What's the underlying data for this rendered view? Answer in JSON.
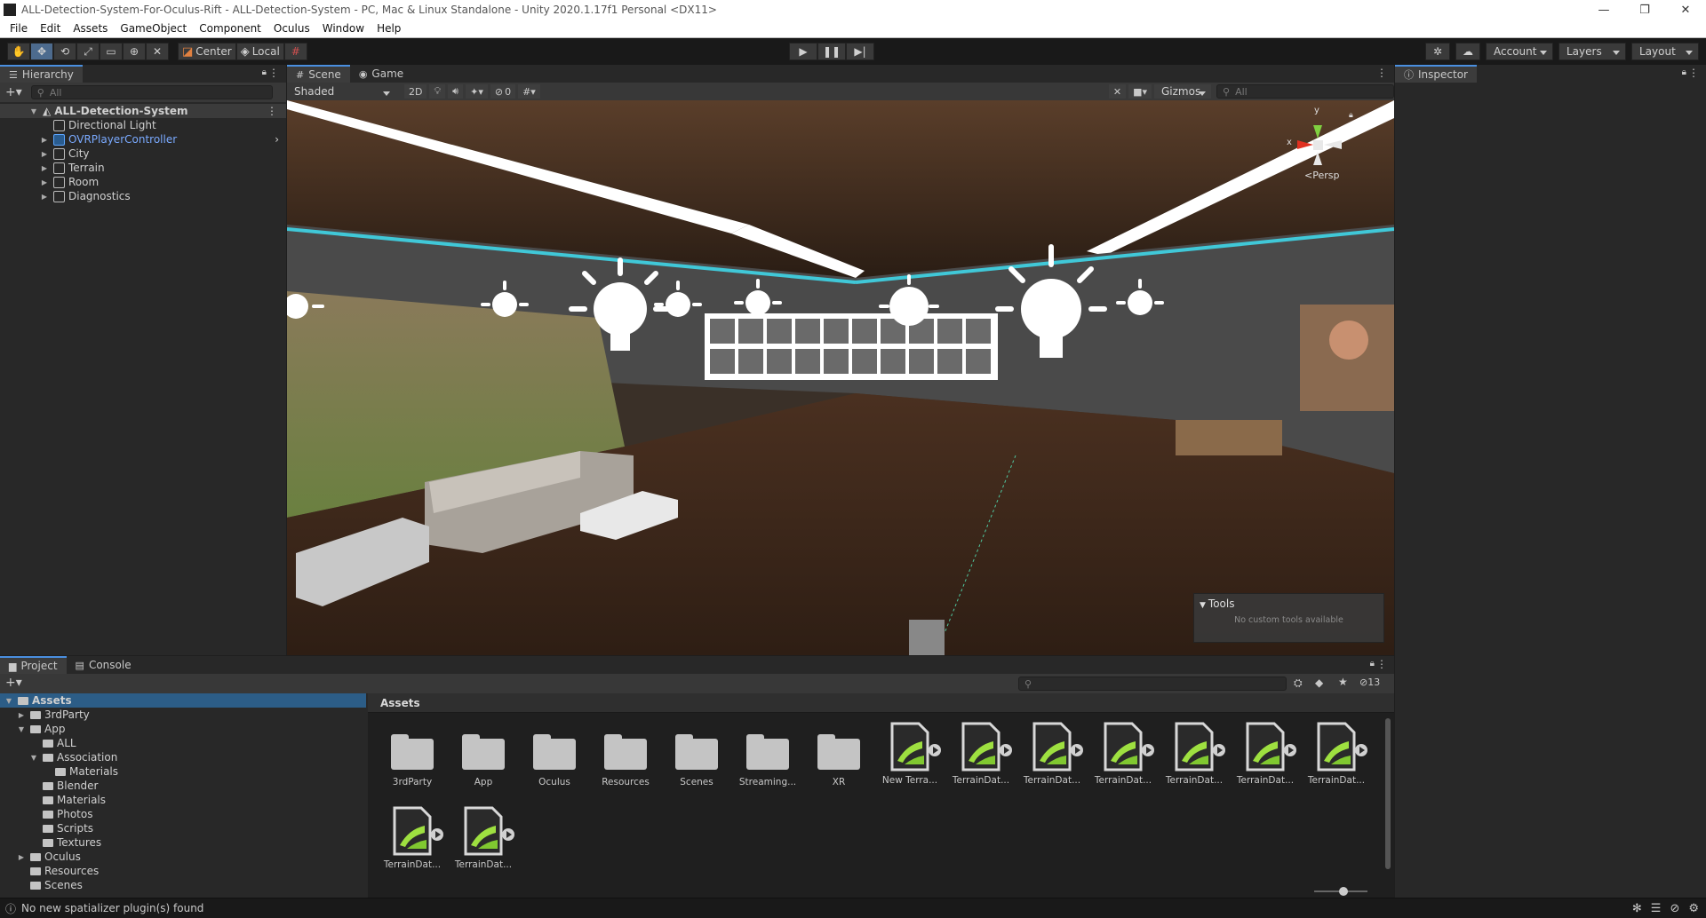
{
  "window": {
    "title": "ALL-Detection-System-For-Oculus-Rift - ALL-Detection-System - PC, Mac & Linux Standalone - Unity 2020.1.17f1 Personal <DX11>",
    "minimize": "—",
    "maximize": "❐",
    "close": "✕"
  },
  "menu": [
    "File",
    "Edit",
    "Assets",
    "GameObject",
    "Component",
    "Oculus",
    "Window",
    "Help"
  ],
  "toolbar": {
    "pivot_mode": "Center",
    "pivot_rotation": "Local",
    "account": "Account",
    "layers": "Layers",
    "layout": "Layout"
  },
  "hierarchy": {
    "tab": "Hierarchy",
    "search_placeholder": "All",
    "scene_name": "ALL-Detection-System",
    "items": [
      "Directional Light",
      "OVRPlayerController",
      "City",
      "Terrain",
      "Room",
      "Diagnostics"
    ]
  },
  "scene": {
    "tab_scene": "Scene",
    "tab_game": "Game",
    "draw_mode": "Shaded",
    "mode_2d": "2D",
    "hidden_count": "0",
    "gizmos": "Gizmos",
    "search_placeholder": "All",
    "persp_label": "Persp",
    "axis_x": "x",
    "axis_y": "y",
    "tools_overlay_title": "Tools",
    "tools_overlay_message": "No custom tools available"
  },
  "inspector": {
    "tab": "Inspector"
  },
  "project": {
    "tab_project": "Project",
    "tab_console": "Console",
    "hidden_count": "13",
    "grid_header": "Assets",
    "tree": [
      {
        "label": "Assets",
        "depth": 0,
        "expanded": true,
        "selected": true
      },
      {
        "label": "3rdParty",
        "depth": 1,
        "expanded": false
      },
      {
        "label": "App",
        "depth": 1,
        "expanded": true
      },
      {
        "label": "ALL",
        "depth": 2
      },
      {
        "label": "Association",
        "depth": 2,
        "expanded": true
      },
      {
        "label": "Materials",
        "depth": 3
      },
      {
        "label": "Blender",
        "depth": 2
      },
      {
        "label": "Materials",
        "depth": 2
      },
      {
        "label": "Photos",
        "depth": 2
      },
      {
        "label": "Scripts",
        "depth": 2
      },
      {
        "label": "Textures",
        "depth": 2
      },
      {
        "label": "Oculus",
        "depth": 1,
        "expanded": false
      },
      {
        "label": "Resources",
        "depth": 1
      },
      {
        "label": "Scenes",
        "depth": 1
      }
    ],
    "assets": [
      {
        "label": "3rdParty",
        "kind": "folder"
      },
      {
        "label": "App",
        "kind": "folder"
      },
      {
        "label": "Oculus",
        "kind": "folder"
      },
      {
        "label": "Resources",
        "kind": "folder"
      },
      {
        "label": "Scenes",
        "kind": "folder"
      },
      {
        "label": "Streaming...",
        "kind": "folder"
      },
      {
        "label": "XR",
        "kind": "folder"
      },
      {
        "label": "New Terra...",
        "kind": "terrain"
      },
      {
        "label": "TerrainDat...",
        "kind": "terrain"
      },
      {
        "label": "TerrainDat...",
        "kind": "terrain"
      },
      {
        "label": "TerrainDat...",
        "kind": "terrain"
      },
      {
        "label": "TerrainDat...",
        "kind": "terrain"
      },
      {
        "label": "TerrainDat...",
        "kind": "terrain"
      },
      {
        "label": "TerrainDat...",
        "kind": "terrain"
      },
      {
        "label": "TerrainDat...",
        "kind": "terrain"
      },
      {
        "label": "TerrainDat...",
        "kind": "terrain"
      }
    ]
  },
  "status": {
    "message": "No new spatializer plugin(s) found"
  }
}
